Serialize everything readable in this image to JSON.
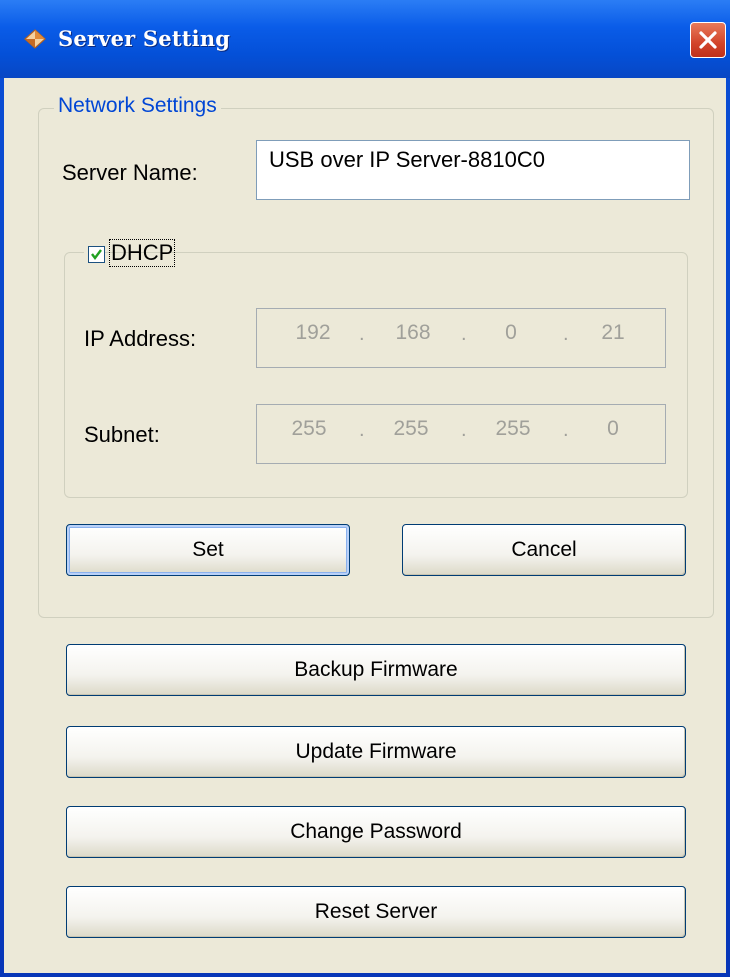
{
  "window": {
    "title": "Server Setting",
    "colors": {
      "titlebar": "#0a5ce8",
      "client": "#ece9d8",
      "accent": "#0046d5",
      "close": "#d2442a"
    }
  },
  "network": {
    "legend": "Network Settings",
    "server_name_label": "Server Name:",
    "server_name_value": "USB over IP Server-8810C0",
    "dhcp": {
      "label": "DHCP",
      "checked": true,
      "ip_label": "IP Address:",
      "ip": [
        "192",
        "168",
        "0",
        "21"
      ],
      "subnet_label": "Subnet:",
      "subnet": [
        "255",
        "255",
        "255",
        "0"
      ]
    },
    "set_label": "Set",
    "cancel_label": "Cancel"
  },
  "actions": {
    "backup_label": "Backup Firmware",
    "update_label": "Update Firmware",
    "password_label": "Change Password",
    "reset_label": "Reset Server"
  },
  "icons": {
    "window": "diamond-app-icon",
    "close": "close-icon",
    "check": "checkmark-icon"
  }
}
